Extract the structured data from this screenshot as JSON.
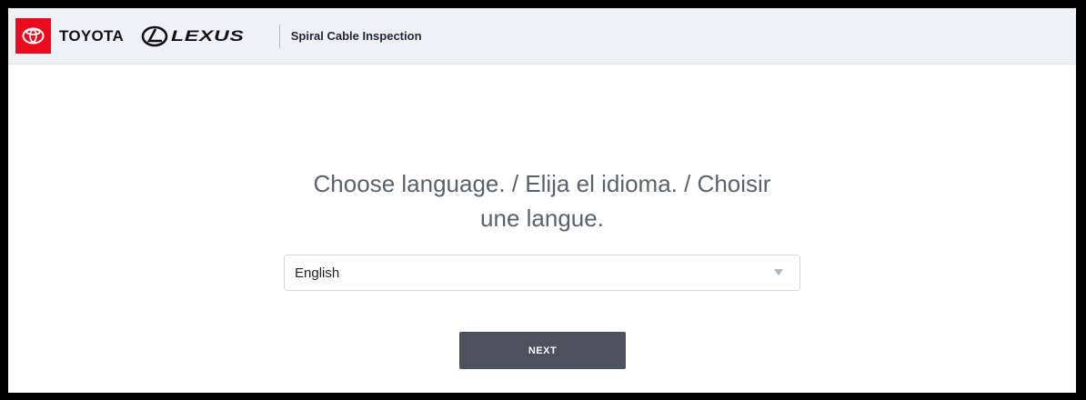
{
  "header": {
    "toyota_logo_text": "TOYOTA",
    "lexus_logo_text": "LEXUS",
    "app_title": "Spiral Cable Inspection",
    "brand_red": "#eb0a1e"
  },
  "main": {
    "prompt_line1": "Choose language. / Elija el idioma. / Choisir",
    "prompt_line2": "une langue.",
    "language_select": {
      "selected": "English",
      "icon": "chevron-down-icon"
    },
    "next_button_label": "NEXT"
  }
}
